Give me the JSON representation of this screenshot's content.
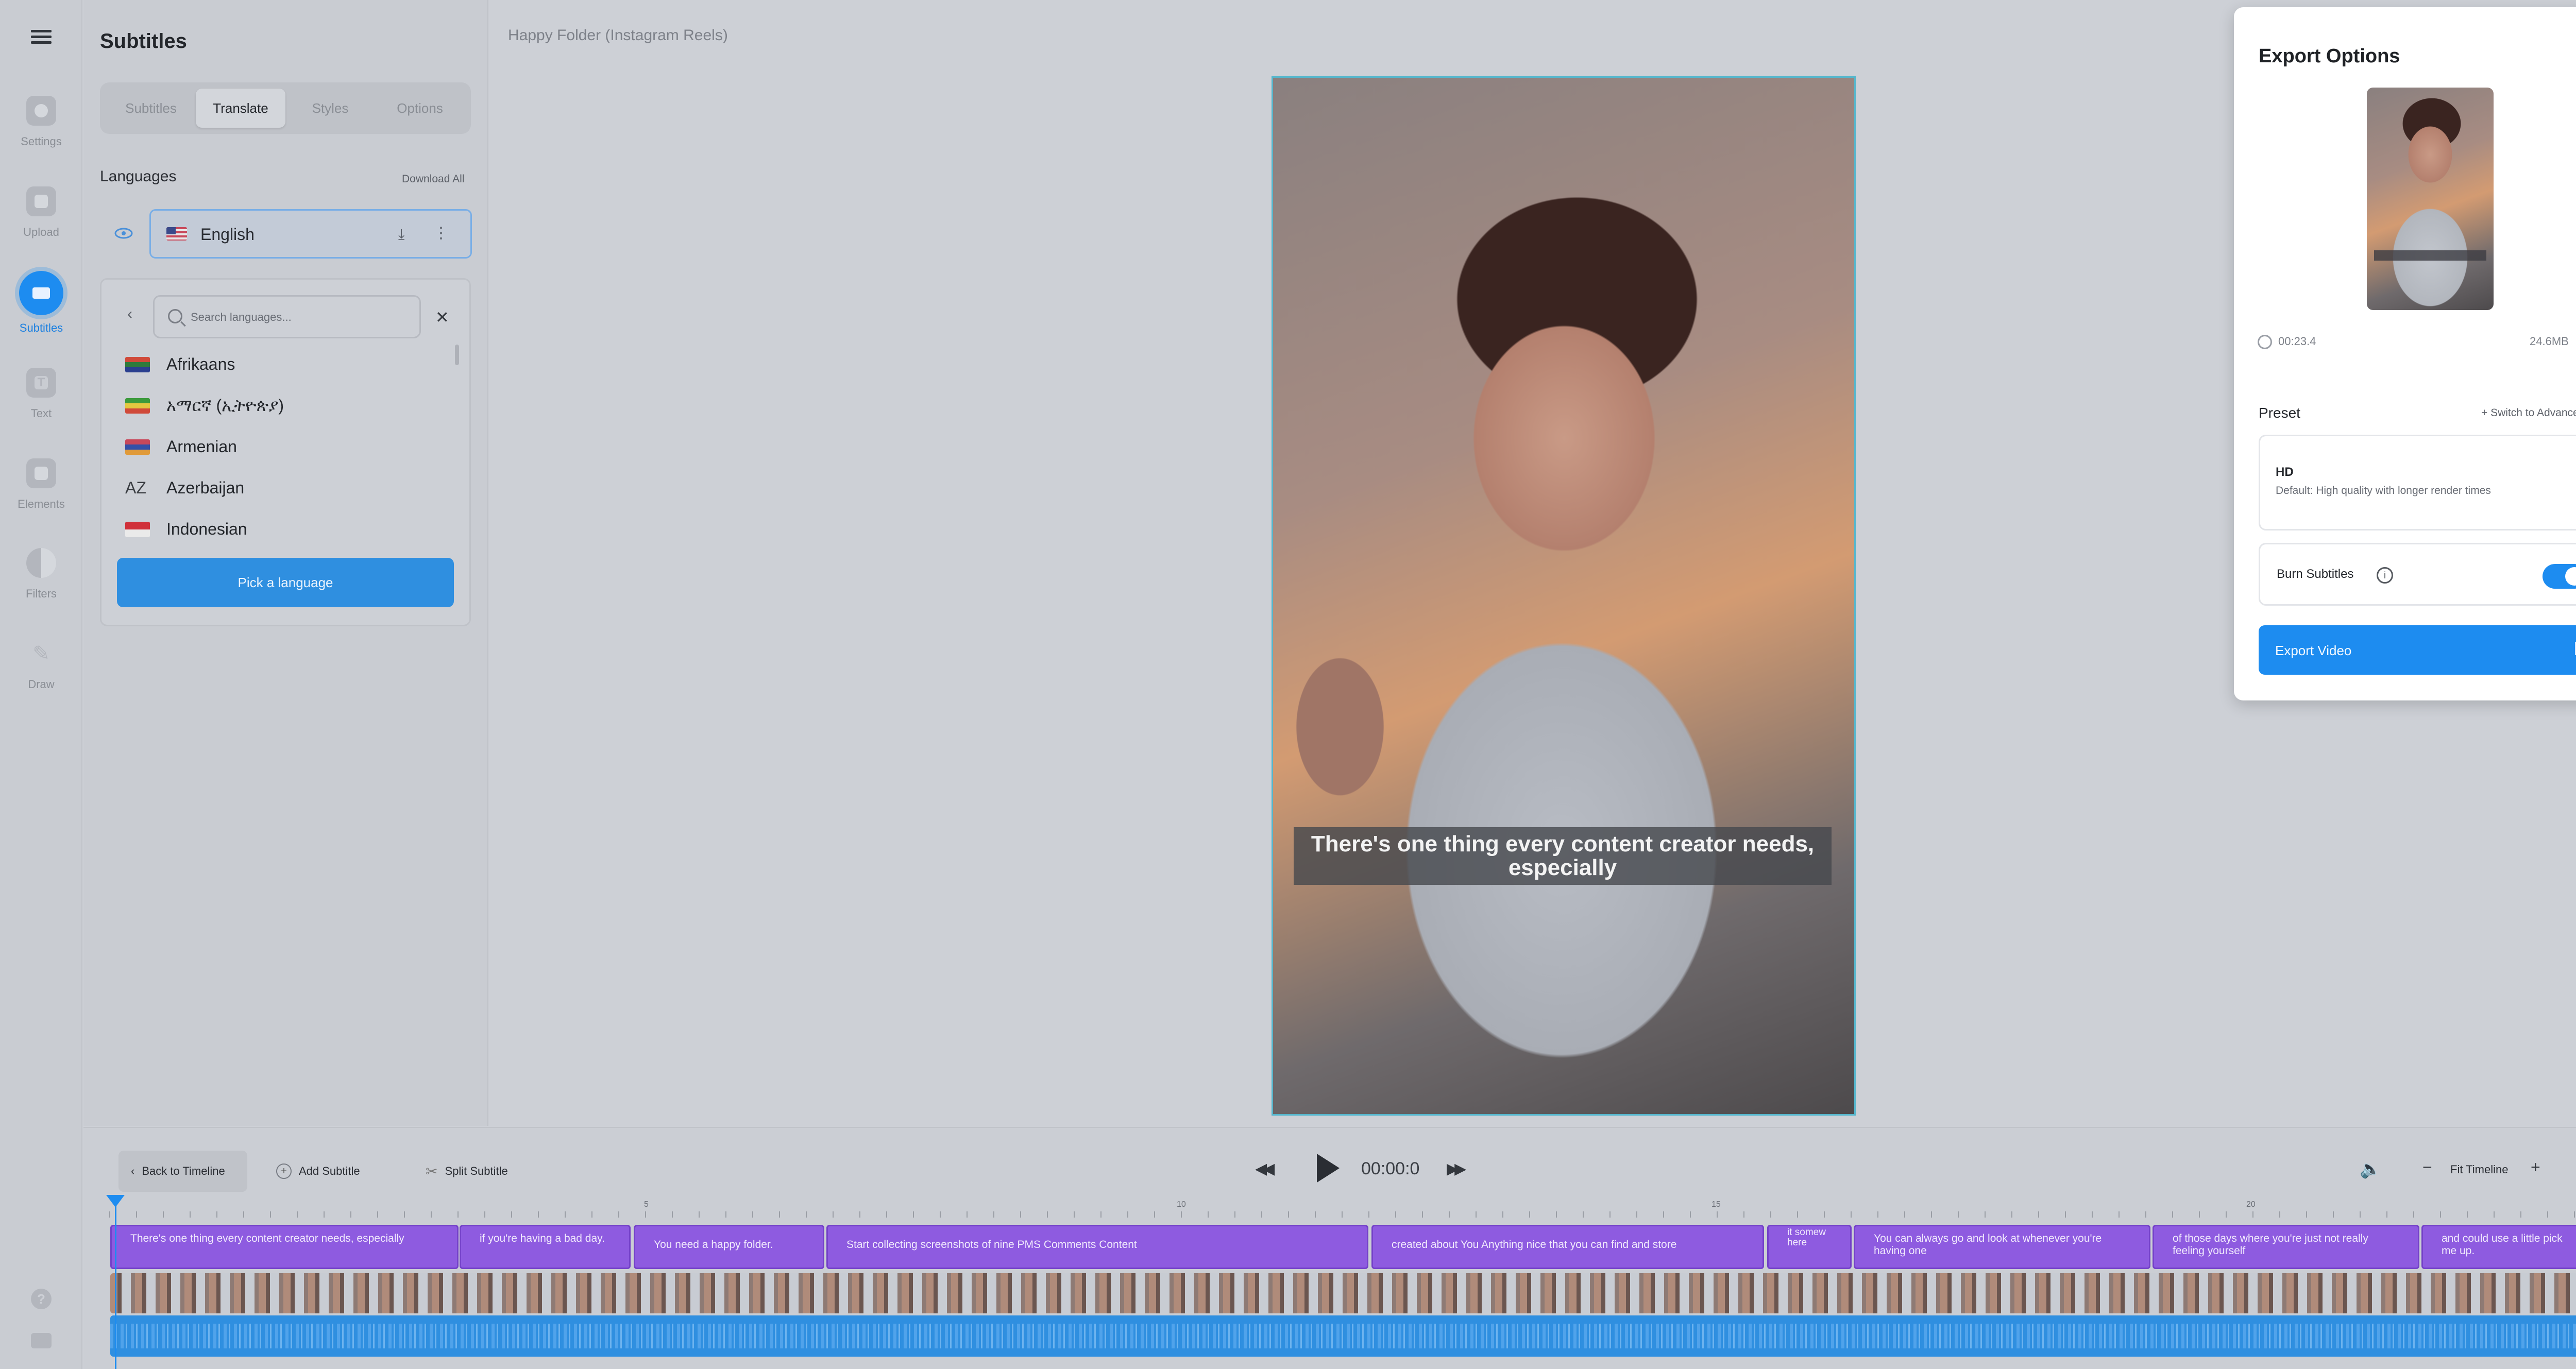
{
  "rail": {
    "items": [
      {
        "label": "Settings",
        "icon": "gear-icon"
      },
      {
        "label": "Upload",
        "icon": "image-icon"
      },
      {
        "label": "Subtitles",
        "icon": "subtitles-icon",
        "active": true
      },
      {
        "label": "Text",
        "icon": "text-icon"
      },
      {
        "label": "Elements",
        "icon": "shapes-icon"
      },
      {
        "label": "Filters",
        "icon": "filter-icon"
      },
      {
        "label": "Draw",
        "icon": "pencil-icon"
      }
    ]
  },
  "panel": {
    "title": "Subtitles",
    "tabs": [
      "Subtitles",
      "Translate",
      "Styles",
      "Options"
    ],
    "active_tab": "Translate",
    "languages_heading": "Languages",
    "download_all": "Download All",
    "current_language": "English",
    "picker": {
      "search_placeholder": "Search languages...",
      "languages": [
        {
          "name": "Afrikaans",
          "flag": "za-flag"
        },
        {
          "name": "አማርኛ (ኢትዮጵያ)",
          "flag": "et-flag"
        },
        {
          "name": "Armenian",
          "flag": "am-flag"
        },
        {
          "name": "Azerbaijan",
          "code": "AZ"
        },
        {
          "name": "Indonesian",
          "flag": "id-flag"
        }
      ],
      "pick_button": "Pick a language"
    }
  },
  "preview": {
    "file_title": "Happy Folder (Instagram Reels)",
    "caption": "There's one thing every content creator needs, especially"
  },
  "export": {
    "title": "Export Options",
    "duration": "00:23.4",
    "size": "24.6MB",
    "preset_label": "Preset",
    "switch_advanced": "+ Switch to Advanced",
    "preset_name": "HD",
    "preset_desc": "Default: High quality with longer render times",
    "burn_label": "Burn Subtitles",
    "burn_enabled": true,
    "export_button": "Export Video"
  },
  "timeline": {
    "back_label": "Back to Timeline",
    "add_label": "Add Subtitle",
    "split_label": "Split Subtitle",
    "time": "00:00:0",
    "fit_label": "Fit Timeline",
    "ruler_labels": [
      "5",
      "10",
      "15",
      "20"
    ],
    "subtitles": [
      "There's one thing every content creator needs, especially",
      "if you're having a bad day.",
      "You need a happy folder.",
      "Start collecting screenshots of nine PMS Comments Content",
      "created about You Anything nice that you can find and store",
      "it somew here",
      "You can always go and look at whenever you're having one",
      "of those days where you're just not really feeling yourself",
      "and could use a little pick me up."
    ]
  },
  "colors": {
    "accent": "#1d8cf0",
    "subtitle_clip": "#8e5be0",
    "video_border": "#55b6cc"
  }
}
